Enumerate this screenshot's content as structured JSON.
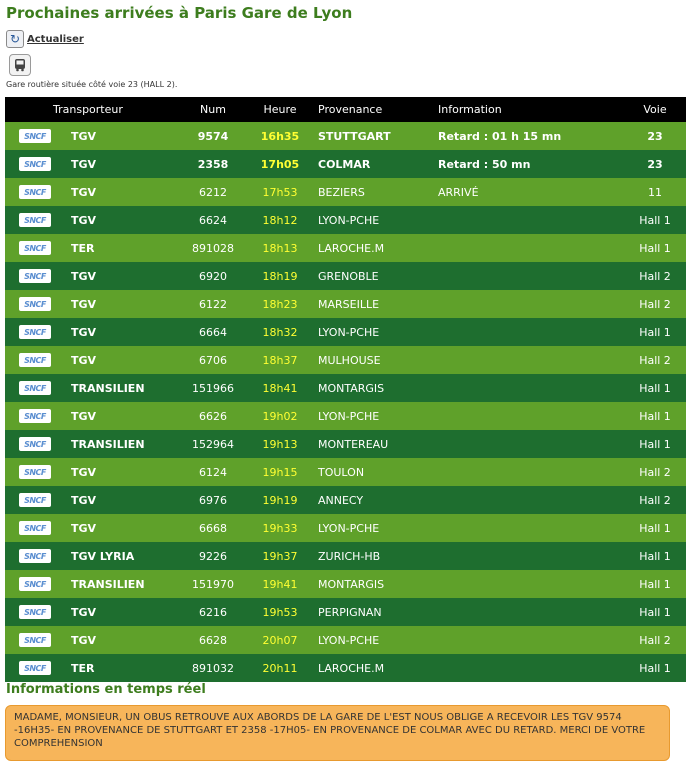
{
  "page": {
    "title": "Prochaines arrivées à Paris Gare de Lyon",
    "refresh_label": "Actualiser",
    "station_note": "Gare routière située côté voie 23 (HALL 2)."
  },
  "icons": {
    "refresh": "refresh-icon",
    "bus": "bus-icon",
    "carrier_logo": "sncf-logo"
  },
  "colors": {
    "title": "#3d7d1e",
    "row_light": "#5fa12a",
    "row_dark": "#1e6e2f",
    "hour": "#ffff33",
    "header_bg": "#000000",
    "alert_bg": "#f7b55a"
  },
  "table": {
    "logo_text": "SNCF",
    "headers": {
      "transporteur": "Transporteur",
      "num": "Num",
      "heure": "Heure",
      "provenance": "Provenance",
      "information": "Information",
      "voie": "Voie"
    },
    "rows": [
      {
        "transporteur": "TGV",
        "num": "9574",
        "heure": "16h35",
        "provenance": "STUTTGART",
        "information": "Retard : 01 h 15 mn",
        "voie": "23"
      },
      {
        "transporteur": "TGV",
        "num": "2358",
        "heure": "17h05",
        "provenance": "COLMAR",
        "information": "Retard : 50 mn",
        "voie": "23"
      },
      {
        "transporteur": "TGV",
        "num": "6212",
        "heure": "17h53",
        "provenance": "BEZIERS",
        "information": "ARRIVÉ",
        "voie": "11"
      },
      {
        "transporteur": "TGV",
        "num": "6624",
        "heure": "18h12",
        "provenance": "LYON-PCHE",
        "information": "",
        "voie": "Hall 1"
      },
      {
        "transporteur": "TER",
        "num": "891028",
        "heure": "18h13",
        "provenance": "LAROCHE.M",
        "information": "",
        "voie": "Hall 1"
      },
      {
        "transporteur": "TGV",
        "num": "6920",
        "heure": "18h19",
        "provenance": "GRENOBLE",
        "information": "",
        "voie": "Hall 2"
      },
      {
        "transporteur": "TGV",
        "num": "6122",
        "heure": "18h23",
        "provenance": "MARSEILLE",
        "information": "",
        "voie": "Hall 2"
      },
      {
        "transporteur": "TGV",
        "num": "6664",
        "heure": "18h32",
        "provenance": "LYON-PCHE",
        "information": "",
        "voie": "Hall 1"
      },
      {
        "transporteur": "TGV",
        "num": "6706",
        "heure": "18h37",
        "provenance": "MULHOUSE",
        "information": "",
        "voie": "Hall 2"
      },
      {
        "transporteur": "TRANSILIEN",
        "num": "151966",
        "heure": "18h41",
        "provenance": "MONTARGIS",
        "information": "",
        "voie": "Hall 1"
      },
      {
        "transporteur": "TGV",
        "num": "6626",
        "heure": "19h02",
        "provenance": "LYON-PCHE",
        "information": "",
        "voie": "Hall 1"
      },
      {
        "transporteur": "TRANSILIEN",
        "num": "152964",
        "heure": "19h13",
        "provenance": "MONTEREAU",
        "information": "",
        "voie": "Hall 1"
      },
      {
        "transporteur": "TGV",
        "num": "6124",
        "heure": "19h15",
        "provenance": "TOULON",
        "information": "",
        "voie": "Hall 2"
      },
      {
        "transporteur": "TGV",
        "num": "6976",
        "heure": "19h19",
        "provenance": "ANNECY",
        "information": "",
        "voie": "Hall 2"
      },
      {
        "transporteur": "TGV",
        "num": "6668",
        "heure": "19h33",
        "provenance": "LYON-PCHE",
        "information": "",
        "voie": "Hall 1"
      },
      {
        "transporteur": "TGV LYRIA",
        "num": "9226",
        "heure": "19h37",
        "provenance": "ZURICH-HB",
        "information": "",
        "voie": "Hall 1"
      },
      {
        "transporteur": "TRANSILIEN",
        "num": "151970",
        "heure": "19h41",
        "provenance": "MONTARGIS",
        "information": "",
        "voie": "Hall 1"
      },
      {
        "transporteur": "TGV",
        "num": "6216",
        "heure": "19h53",
        "provenance": "PERPIGNAN",
        "information": "",
        "voie": "Hall 1"
      },
      {
        "transporteur": "TGV",
        "num": "6628",
        "heure": "20h07",
        "provenance": "LYON-PCHE",
        "information": "",
        "voie": "Hall 2"
      },
      {
        "transporteur": "TER",
        "num": "891032",
        "heure": "20h11",
        "provenance": "LAROCHE.M",
        "information": "",
        "voie": "Hall 1"
      }
    ]
  },
  "realtime": {
    "title": "Informations en temps réel",
    "message": "MADAME, MONSIEUR, UN OBUS RETROUVE AUX ABORDS DE LA GARE DE L'EST NOUS OBLIGE A RECEVOIR LES TGV 9574 -16H35- EN PROVENANCE DE STUTTGART ET 2358 -17H05- EN PROVENANCE DE COLMAR AVEC DU RETARD. MERCI DE VOTRE COMPREHENSION"
  }
}
